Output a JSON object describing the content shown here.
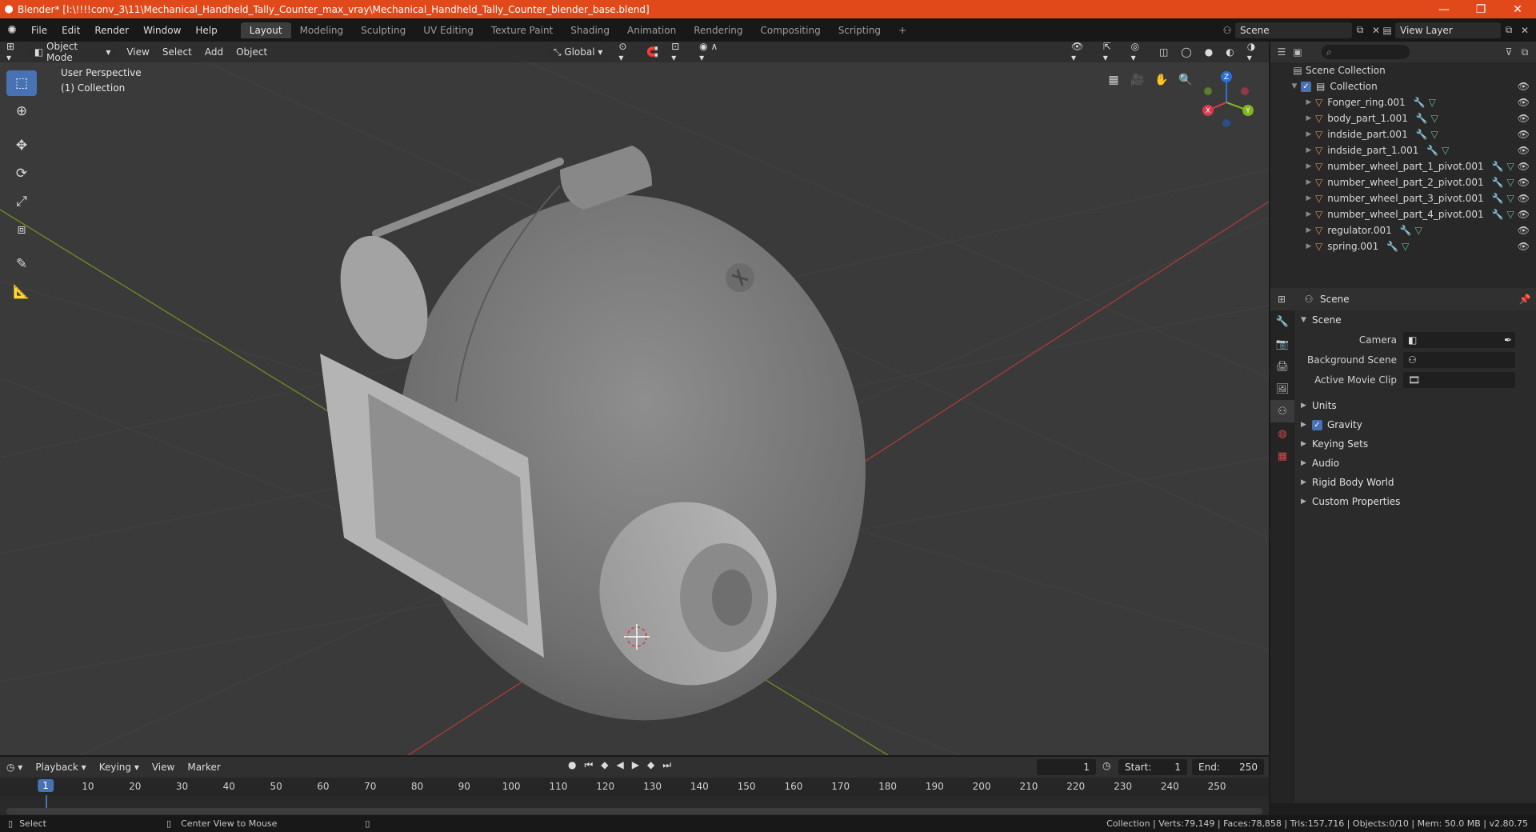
{
  "titlebar": {
    "title": "Blender* [I:\\!!!!conv_3\\11\\Mechanical_Handheld_Tally_Counter_max_vray\\Mechanical_Handheld_Tally_Counter_blender_base.blend]",
    "minimize": "—",
    "restore": "❐",
    "close": "✕"
  },
  "menu": {
    "file": "File",
    "edit": "Edit",
    "render": "Render",
    "window": "Window",
    "help": "Help"
  },
  "workspaces": [
    "Layout",
    "Modeling",
    "Sculpting",
    "UV Editing",
    "Texture Paint",
    "Shading",
    "Animation",
    "Rendering",
    "Compositing",
    "Scripting",
    "+"
  ],
  "scene": {
    "label": "Scene"
  },
  "view_layer": {
    "label": "View Layer"
  },
  "viewport": {
    "mode": "Object Mode",
    "view": "View",
    "select": "Select",
    "add": "Add",
    "object": "Object",
    "transform": "Global",
    "info_line1": "User Perspective",
    "info_line2": "(1) Collection"
  },
  "gizmo": {
    "z": "Z",
    "y": "Y",
    "x": "X"
  },
  "outliner": {
    "root": "Scene Collection",
    "collection": "Collection",
    "objects": [
      {
        "name": "Fonger_ring.001"
      },
      {
        "name": "body_part_1.001"
      },
      {
        "name": "indside_part.001"
      },
      {
        "name": "indside_part_1.001"
      },
      {
        "name": "number_wheel_part_1_pivot.001"
      },
      {
        "name": "number_wheel_part_2_pivot.001"
      },
      {
        "name": "number_wheel_part_3_pivot.001"
      },
      {
        "name": "number_wheel_part_4_pivot.001"
      },
      {
        "name": "regulator.001"
      },
      {
        "name": "spring.001"
      }
    ]
  },
  "properties": {
    "header": "Scene",
    "section": "Scene",
    "rows": [
      {
        "label": "Camera"
      },
      {
        "label": "Background Scene"
      },
      {
        "label": "Active Movie Clip"
      }
    ],
    "subsections": [
      "Units",
      "Gravity",
      "Keying Sets",
      "Audio",
      "Rigid Body World",
      "Custom Properties"
    ]
  },
  "timeline": {
    "playback": "Playback",
    "keying": "Keying",
    "view": "View",
    "marker": "Marker",
    "current_frame": "1",
    "start_label": "Start:",
    "start": "1",
    "end_label": "End:",
    "end": "250",
    "ticks": [
      "10",
      "20",
      "30",
      "40",
      "50",
      "60",
      "70",
      "80",
      "90",
      "100",
      "110",
      "120",
      "130",
      "140",
      "150",
      "160",
      "170",
      "180",
      "190",
      "200",
      "210",
      "220",
      "230",
      "240",
      "250"
    ]
  },
  "status": {
    "select": "Select",
    "center_view": "Center View to Mouse",
    "stats": "Collection | Verts:79,149 | Faces:78,858 | Tris:157,716 | Objects:0/10 | Mem: 50.0 MB | v2.80.75"
  }
}
